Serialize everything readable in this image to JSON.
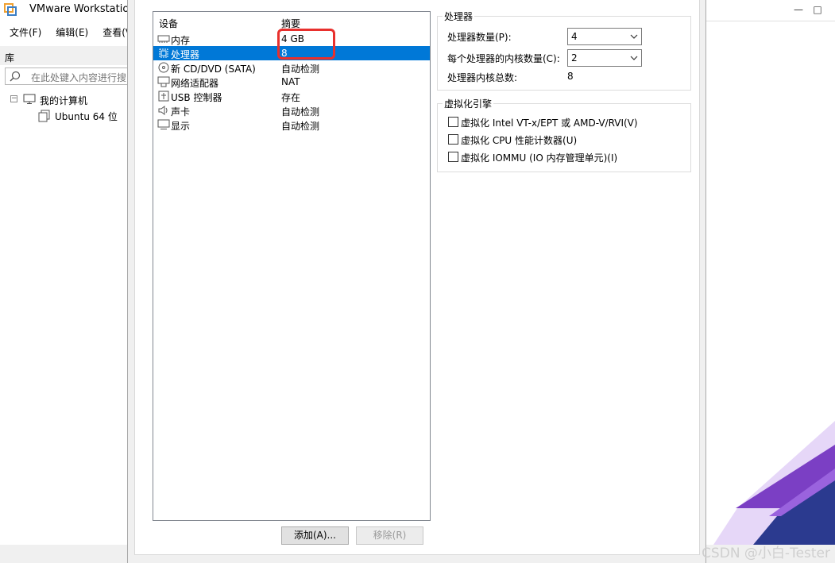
{
  "main_window": {
    "title": "VMware Workstation",
    "menu": [
      "文件(F)",
      "编辑(E)",
      "查看(V)"
    ],
    "library": {
      "header": "库",
      "search_placeholder": "在此处键入内容进行搜",
      "tree": [
        {
          "label": "我的计算机",
          "icon": "computer-icon"
        },
        {
          "label": "Ubuntu 64 位",
          "icon": "vm-icon"
        }
      ]
    },
    "controls": [
      "—",
      "□"
    ]
  },
  "dialog": {
    "devices": {
      "header_device": "设备",
      "header_summary": "摘要",
      "items": [
        {
          "name": "内存",
          "summary": "4 GB",
          "icon": "memory-icon",
          "selected": false
        },
        {
          "name": "处理器",
          "summary": "8",
          "icon": "processor-icon",
          "selected": true
        },
        {
          "name": "新 CD/DVD (SATA)",
          "summary": "自动检测",
          "icon": "cd-dvd-icon",
          "selected": false
        },
        {
          "name": "网络适配器",
          "summary": "NAT",
          "icon": "network-adapter-icon",
          "selected": false
        },
        {
          "name": "USB 控制器",
          "summary": "存在",
          "icon": "usb-icon",
          "selected": false
        },
        {
          "name": "声卡",
          "summary": "自动检测",
          "icon": "sound-card-icon",
          "selected": false
        },
        {
          "name": "显示",
          "summary": "自动检测",
          "icon": "display-icon",
          "selected": false
        }
      ],
      "add_button": "添加(A)...",
      "remove_button": "移除(R)"
    },
    "processor": {
      "group_title": "处理器",
      "count_label": "处理器数量(P):",
      "count_value": "4",
      "cores_label": "每个处理器的内核数量(C):",
      "cores_value": "2",
      "total_label": "处理器内核总数:",
      "total_value": "8"
    },
    "virtualization": {
      "group_title": "虚拟化引擎",
      "options": [
        {
          "label": "虚拟化 Intel VT-x/EPT 或 AMD-V/RVI(V)",
          "checked": false
        },
        {
          "label": "虚拟化 CPU 性能计数器(U)",
          "checked": false
        },
        {
          "label": "虚拟化 IOMMU (IO 内存管理单元)(I)",
          "checked": false
        }
      ]
    }
  },
  "watermark": "CSDN @小白-Tester",
  "colors": {
    "selection": "#0078d7",
    "highlight_box": "#e8302d",
    "deco_purple": "#7b3fc4",
    "deco_navy": "#2b3a8f"
  }
}
